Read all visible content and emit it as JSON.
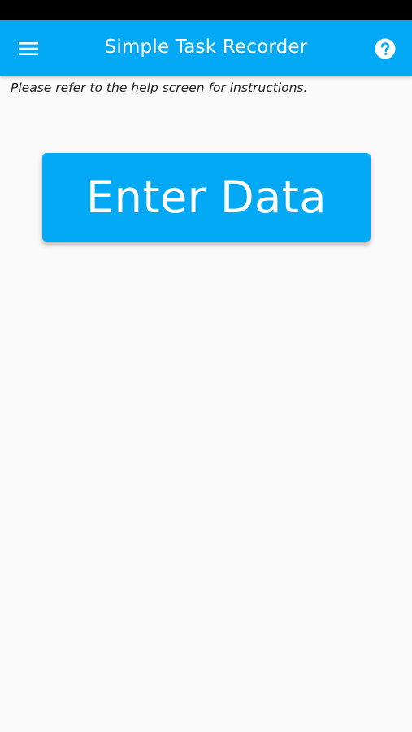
{
  "app_bar": {
    "title": "Simple Task Recorder",
    "menu_icon": "hamburger-menu-icon",
    "help_icon": "help-circle-icon",
    "color": "#03a9f4"
  },
  "main": {
    "help_text": "Please refer to the help screen for instructions.",
    "enter_data_label": "Enter Data",
    "button_color": "#03a9f4"
  }
}
